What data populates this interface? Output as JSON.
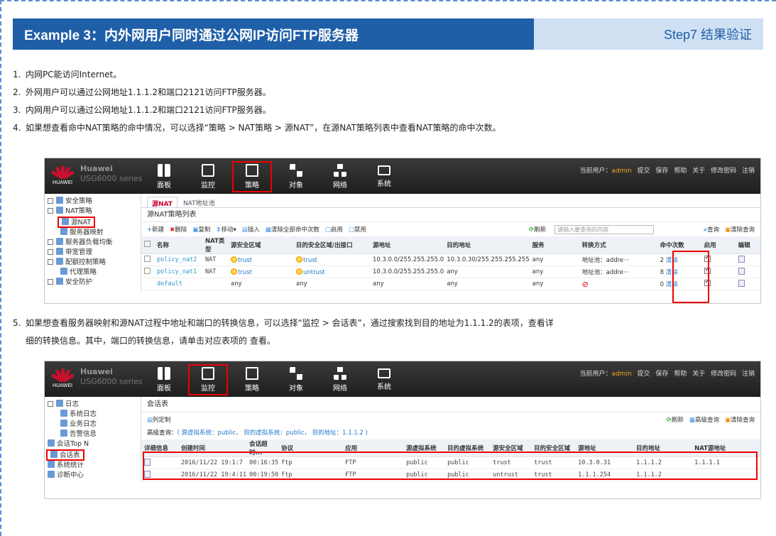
{
  "header": {
    "title": "Example 3：内外网用户同时通过公网IP访问FTP服务器",
    "step": "Step7 结果验证"
  },
  "steps": [
    {
      "num": "1.",
      "text": "内网PC能访问Internet。"
    },
    {
      "num": "2.",
      "text": "外网用户可以通过公网地址1.1.1.2和端口2121访问FTP服务器。"
    },
    {
      "num": "3.",
      "text": "内网用户可以通过公网地址1.1.1.2和端口2121访问FTP服务器。"
    },
    {
      "num": "4.",
      "text": "如果想查看命中NAT策略的命中情况，可以选择“策略 > NAT策略 > 源NAT”，在源NAT策略列表中查看NAT策略的命中次数。"
    },
    {
      "num": "5.",
      "text": "如果想查看服务器映射和源NAT过程中地址和端口的转换信息，可以选择“监控 > 会话表”，通过搜索找到目的地址为1.1.1.2的表项，查看详"
    },
    {
      "num": "",
      "text": "细的转换信息。其中，端口的转换信息，请单击对应表项的 查看。"
    }
  ],
  "topbar": {
    "logo_text": "HUAWEI",
    "brand1": "Huawei",
    "brand2": "USG6000 series",
    "nav": [
      "面板",
      "监控",
      "策略",
      "对象",
      "网络",
      "系统"
    ],
    "user_label": "当前用户：",
    "user": "admin",
    "links": [
      "提交",
      "保存",
      "帮助",
      "关于",
      "修改密码",
      "注销"
    ]
  },
  "shot1": {
    "sidebar": [
      {
        "label": "安全策略",
        "level": 1
      },
      {
        "label": "NAT策略",
        "level": 1
      },
      {
        "label": "源NAT",
        "level": 2,
        "boxed": true
      },
      {
        "label": "服务器映射",
        "level": 2
      },
      {
        "label": "服务器负载均衡",
        "level": 1
      },
      {
        "label": "带宽管理",
        "level": 1
      },
      {
        "label": "配额控制策略",
        "level": 1
      },
      {
        "label": "代理策略",
        "level": 2
      },
      {
        "label": "安全防护",
        "level": 1
      }
    ],
    "tabs": [
      "源NAT",
      "NAT地址池"
    ],
    "panel_title": "源NAT策略列表",
    "toolbar": [
      "新建",
      "删除",
      "复制",
      "移动",
      "插入",
      "清除全部命中次数",
      "启用",
      "禁用"
    ],
    "refresh": "刷新",
    "search_placeholder": "请输入要查询的内容",
    "query": "查询",
    "clear_query": "清除查询",
    "columns": [
      "名称",
      "NAT类型",
      "源安全区域",
      "目的安全区域/出接口",
      "源地址",
      "目的地址",
      "服务",
      "转换方式",
      "命中次数",
      "启用",
      "编辑"
    ],
    "rows": [
      {
        "name": "policy_nat2",
        "type": "NAT",
        "src_zone": "trust",
        "dst_zone": "trust",
        "src": "10.3.0.0/255.255.255.0",
        "dst": "10.3.0.30/255.255.255.255",
        "svc": "any",
        "conv": "地址池：addre···",
        "hits": "2",
        "clear": "清除"
      },
      {
        "name": "policy_nat1",
        "type": "NAT",
        "src_zone": "trust",
        "dst_zone": "untrust",
        "src": "10.3.0.0/255.255.255.0",
        "dst": "any",
        "svc": "any",
        "conv": "地址池：addre···",
        "hits": "8",
        "clear": "清除"
      },
      {
        "name": "default",
        "type": "",
        "src_zone": "any",
        "dst_zone": "any",
        "src": "any",
        "dst": "any",
        "svc": "any",
        "conv": "",
        "hits": "0",
        "clear": "清除"
      }
    ]
  },
  "shot2": {
    "sidebar": [
      {
        "label": "日志",
        "level": 1
      },
      {
        "label": "系统日志",
        "level": 2
      },
      {
        "label": "业务日志",
        "level": 2
      },
      {
        "label": "告警信息",
        "level": 2
      },
      {
        "label": "会话Top N",
        "level": 1
      },
      {
        "label": "会话表",
        "level": 1,
        "boxed": true
      },
      {
        "label": "系统统计",
        "level": 1
      },
      {
        "label": "诊断中心",
        "level": 1
      }
    ],
    "panel_title": "会话表",
    "custom": "列定制",
    "refresh": "刷新",
    "adv_query": "高级查询",
    "clear_query": "清除查询",
    "adv_label": "高级查询：",
    "adv_value": "( 源虚拟系统：public， 目的虚拟系统：public， 目的地址：1.1.1.2 )",
    "columns": [
      "详细信息",
      "创建时间",
      "会话超时...",
      "协议",
      "应用",
      "源虚拟系统",
      "目的虚拟系统",
      "源安全区域",
      "目的安全区域",
      "源地址",
      "目的地址",
      "NAT源地址"
    ],
    "rows": [
      {
        "created": "2016/11/22 19:1:7",
        "timeout": "00:16:35",
        "proto": "ftp",
        "app": "FTP",
        "svsys": "public",
        "dvsys": "public",
        "szone": "trust",
        "dzone": "trust",
        "src": "10.3.0.31",
        "dst": "1.1.1.2",
        "natsrc": "1.1.1.1"
      },
      {
        "created": "2016/11/22 19:4:11",
        "timeout": "00:19:50",
        "proto": "ftp",
        "app": "FTP",
        "svsys": "public",
        "dvsys": "public",
        "szone": "untrust",
        "dzone": "trust",
        "src": "1.1.1.254",
        "dst": "1.1.1.2",
        "natsrc": ""
      }
    ]
  }
}
